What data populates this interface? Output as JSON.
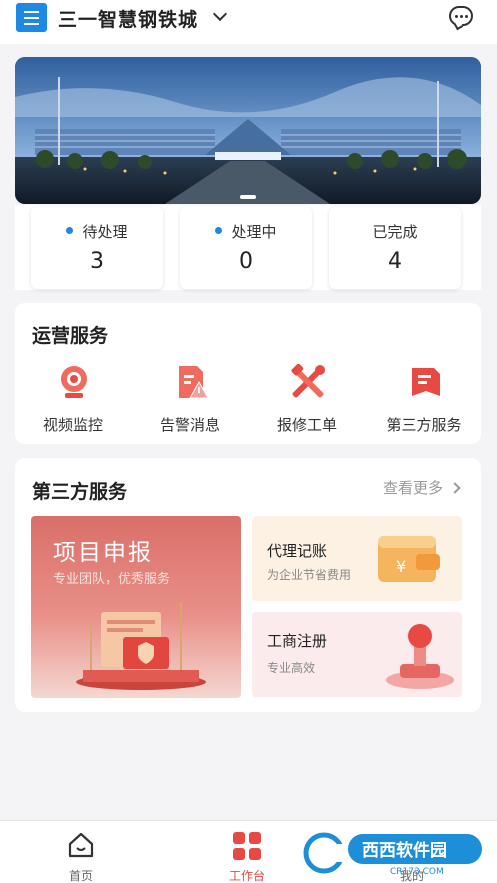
{
  "header": {
    "title": "三一智慧钢铁城",
    "menu_icon": "menu-icon",
    "message_icon": "chat-icon"
  },
  "banner": {
    "description_icon": "building-photo",
    "pages": 1
  },
  "stats": [
    {
      "label": "待处理",
      "value": "3",
      "dot": true
    },
    {
      "label": "处理中",
      "value": "0",
      "dot": true
    },
    {
      "label": "已完成",
      "value": "4",
      "dot": false
    }
  ],
  "operations": {
    "title": "运营服务",
    "items": [
      {
        "label": "视频监控",
        "icon": "camera-icon"
      },
      {
        "label": "告警消息",
        "icon": "alert-icon"
      },
      {
        "label": "报修工单",
        "icon": "repair-icon"
      },
      {
        "label": "第三方服务",
        "icon": "document-icon"
      }
    ]
  },
  "third_party": {
    "title": "第三方服务",
    "more": "查看更多",
    "feature": {
      "title": "项目申报",
      "subtitle": "专业团队，优秀服务"
    },
    "tiles": [
      {
        "title": "代理记账",
        "subtitle": "为企业节省费用"
      },
      {
        "title": "工商注册",
        "subtitle": "专业高效"
      }
    ]
  },
  "tabbar": {
    "tabs": [
      {
        "label": "首页",
        "icon": "home-icon"
      },
      {
        "label": "工作台",
        "icon": "grid-icon"
      },
      {
        "label": "我的",
        "icon": "profile-icon"
      }
    ],
    "active": 1
  },
  "watermark": {
    "text": "西西软件园",
    "url": "CR173.COM"
  },
  "colors": {
    "accent": "#e84a43",
    "primary": "#1e88e5",
    "background": "#f4f4f6"
  }
}
